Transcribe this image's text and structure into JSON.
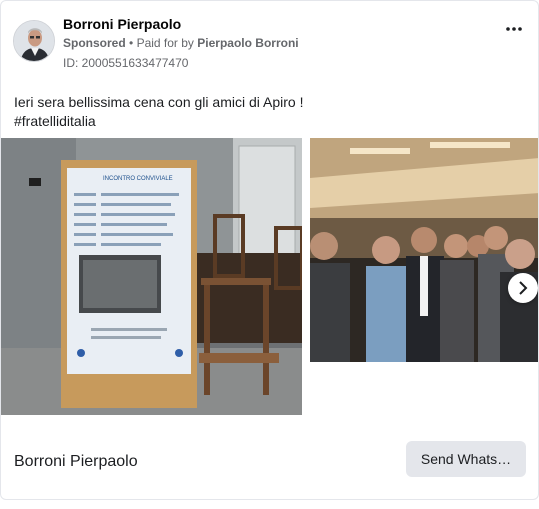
{
  "post": {
    "author": "Borroni Pierpaolo",
    "sponsored": "Sponsored",
    "separator": "•",
    "paid_for_prefix": "Paid for by",
    "paid_for_name": "Pierpaolo Borroni",
    "id_line": "ID: 2000551633477470",
    "text_line1": "Ieri sera bellissima cena con gli amici di Apiro !",
    "text_line2": "#fratelliditalia",
    "more_icon": "more-horizontal-icon"
  },
  "poster": {
    "heading": "INCONTRO CONVIVIALE"
  },
  "footer": {
    "title": "Borroni Pierpaolo",
    "cta_label": "Send Whats…"
  },
  "carousel": {
    "next_icon": "chevron-right-icon"
  }
}
